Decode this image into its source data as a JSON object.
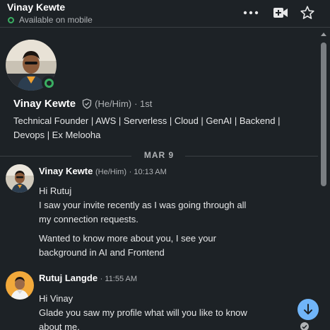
{
  "header": {
    "name": "Vinay Kewte",
    "status": "Available on mobile",
    "icons": [
      "more-options-icon",
      "video-call-icon",
      "star-icon"
    ]
  },
  "profile": {
    "name": "Vinay Kewte",
    "pronouns": "(He/Him)",
    "degree": "· 1st",
    "headline_line1": "Technical Founder | AWS | Serverless | Cloud | GenAI | Backend |",
    "headline_line2": "Devops | Ex Melooha",
    "online": true
  },
  "date_separator": "MAR 9",
  "messages": [
    {
      "sender": "Vinay Kewte",
      "pronouns": "(He/Him)",
      "time": "· 10:13 AM",
      "lines": [
        "Hi Rutuj",
        "I saw your invite recently as I was going through all",
        "my connection requests."
      ],
      "lines2": [
        "Wanted to know more about you, I see your",
        "background in AI and Frontend"
      ]
    },
    {
      "sender": "Rutuj Langde",
      "time": "· 11:55 AM",
      "lines": [
        "Hi Vinay",
        "Glade you saw my profile what will you like to know",
        "about me."
      ]
    }
  ],
  "colors": {
    "background": "#1d2226",
    "online_green": "#3aae62",
    "accent_blue": "#70b5f9"
  }
}
